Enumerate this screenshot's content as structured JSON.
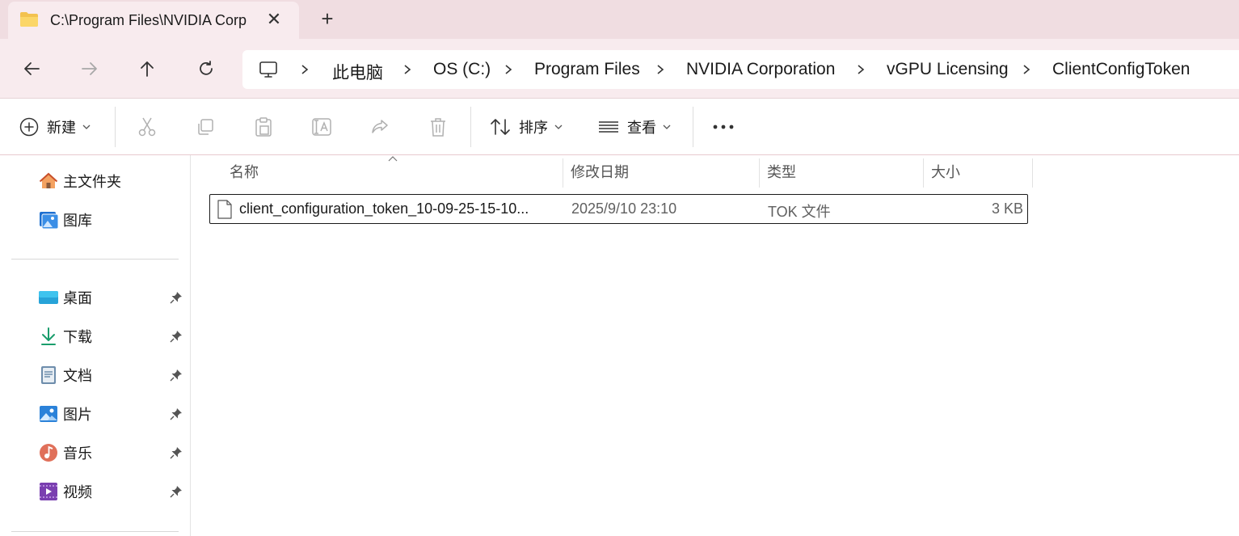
{
  "tab": {
    "title": "C:\\Program Files\\NVIDIA Corp",
    "close_glyph": "✕",
    "new_tab_glyph": "+"
  },
  "nav": {
    "back_icon": "arrow-left-icon",
    "forward_icon": "arrow-right-icon",
    "up_icon": "arrow-up-icon",
    "refresh_icon": "refresh-icon"
  },
  "breadcrumb": {
    "items": [
      "此电脑",
      "OS (C:)",
      "Program Files",
      "NVIDIA Corporation",
      "vGPU Licensing",
      "ClientConfigToken"
    ]
  },
  "toolbar": {
    "new_label": "新建",
    "sort_label": "排序",
    "view_label": "查看",
    "more_glyph": "•••"
  },
  "sidebar": {
    "top": [
      {
        "label": "主文件夹",
        "icon": "home-icon"
      },
      {
        "label": "图库",
        "icon": "gallery-icon"
      }
    ],
    "pinned": [
      {
        "label": "桌面",
        "icon": "desktop-icon"
      },
      {
        "label": "下载",
        "icon": "download-icon"
      },
      {
        "label": "文档",
        "icon": "documents-icon"
      },
      {
        "label": "图片",
        "icon": "pictures-icon"
      },
      {
        "label": "音乐",
        "icon": "music-icon"
      },
      {
        "label": "视频",
        "icon": "videos-icon"
      }
    ]
  },
  "columns": {
    "name": "名称",
    "modified": "修改日期",
    "type": "类型",
    "size": "大小"
  },
  "files": [
    {
      "name": "client_configuration_token_10-09-25-15-10...",
      "modified": "2025/9/10 23:10",
      "type": "TOK 文件",
      "size": "3 KB"
    }
  ],
  "colors": {
    "title_bg": "#f0dde1",
    "nav_bg": "#f8ebee",
    "accent": "#0067c0"
  }
}
